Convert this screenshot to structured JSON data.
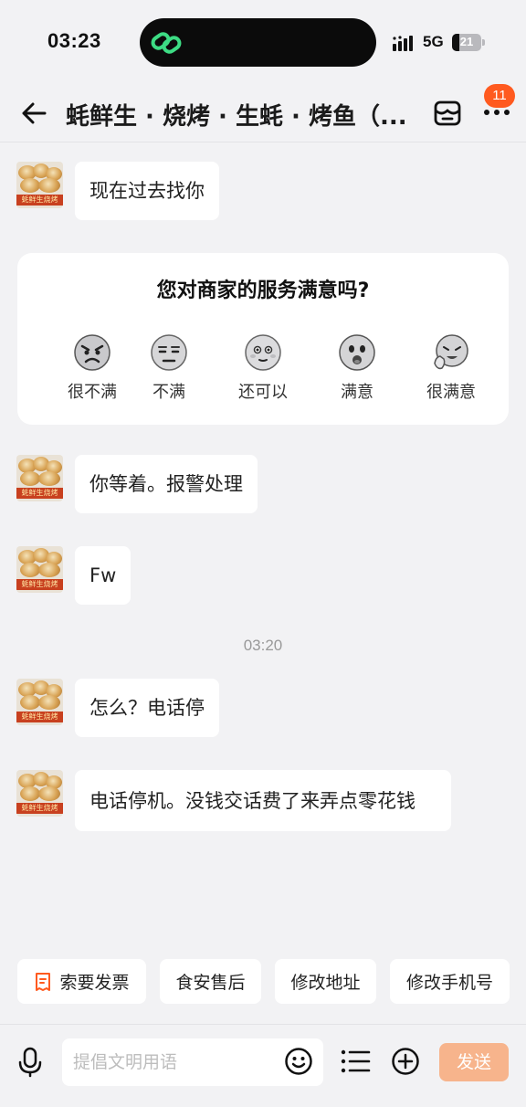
{
  "status_bar": {
    "time": "03:23",
    "network": "5G",
    "battery": "21",
    "island_icon": "link-rings-icon"
  },
  "header": {
    "title": "蚝鲜生 · 烧烤 · 生蚝 · 烤鱼（...",
    "badge_count": "11",
    "icons": [
      "back-arrow-icon",
      "shop-icon",
      "more-dots-icon"
    ]
  },
  "avatar_sign": "蚝鲜生烧烤",
  "messages": [
    {
      "text": "现在过去找你"
    },
    {
      "text": "你等着。报警处理"
    },
    {
      "text": "Fw"
    },
    {
      "text": "怎么？电话停"
    },
    {
      "text": "电话停机。没钱交话费了来弄点零花钱"
    }
  ],
  "survey": {
    "title": "您对商家的服务满意吗?",
    "options": [
      {
        "label": "很不满",
        "icon": "angry-face-icon"
      },
      {
        "label": "不满",
        "icon": "unamused-face-icon"
      },
      {
        "label": "还可以",
        "icon": "neutral-face-icon"
      },
      {
        "label": "满意",
        "icon": "happy-face-icon"
      },
      {
        "label": "很满意",
        "icon": "thumbs-up-face-icon"
      }
    ]
  },
  "timestamp": "03:20",
  "quick_actions": [
    {
      "label": "索要发票",
      "icon": "invoice-icon"
    },
    {
      "label": "食安售后"
    },
    {
      "label": "修改地址"
    },
    {
      "label": "修改手机号"
    }
  ],
  "input": {
    "placeholder": "提倡文明用语",
    "value": "",
    "send_label": "发送"
  },
  "colors": {
    "accent": "#ff5a1f",
    "send_disabled": "#f7b48c",
    "background": "#f2f2f4"
  }
}
